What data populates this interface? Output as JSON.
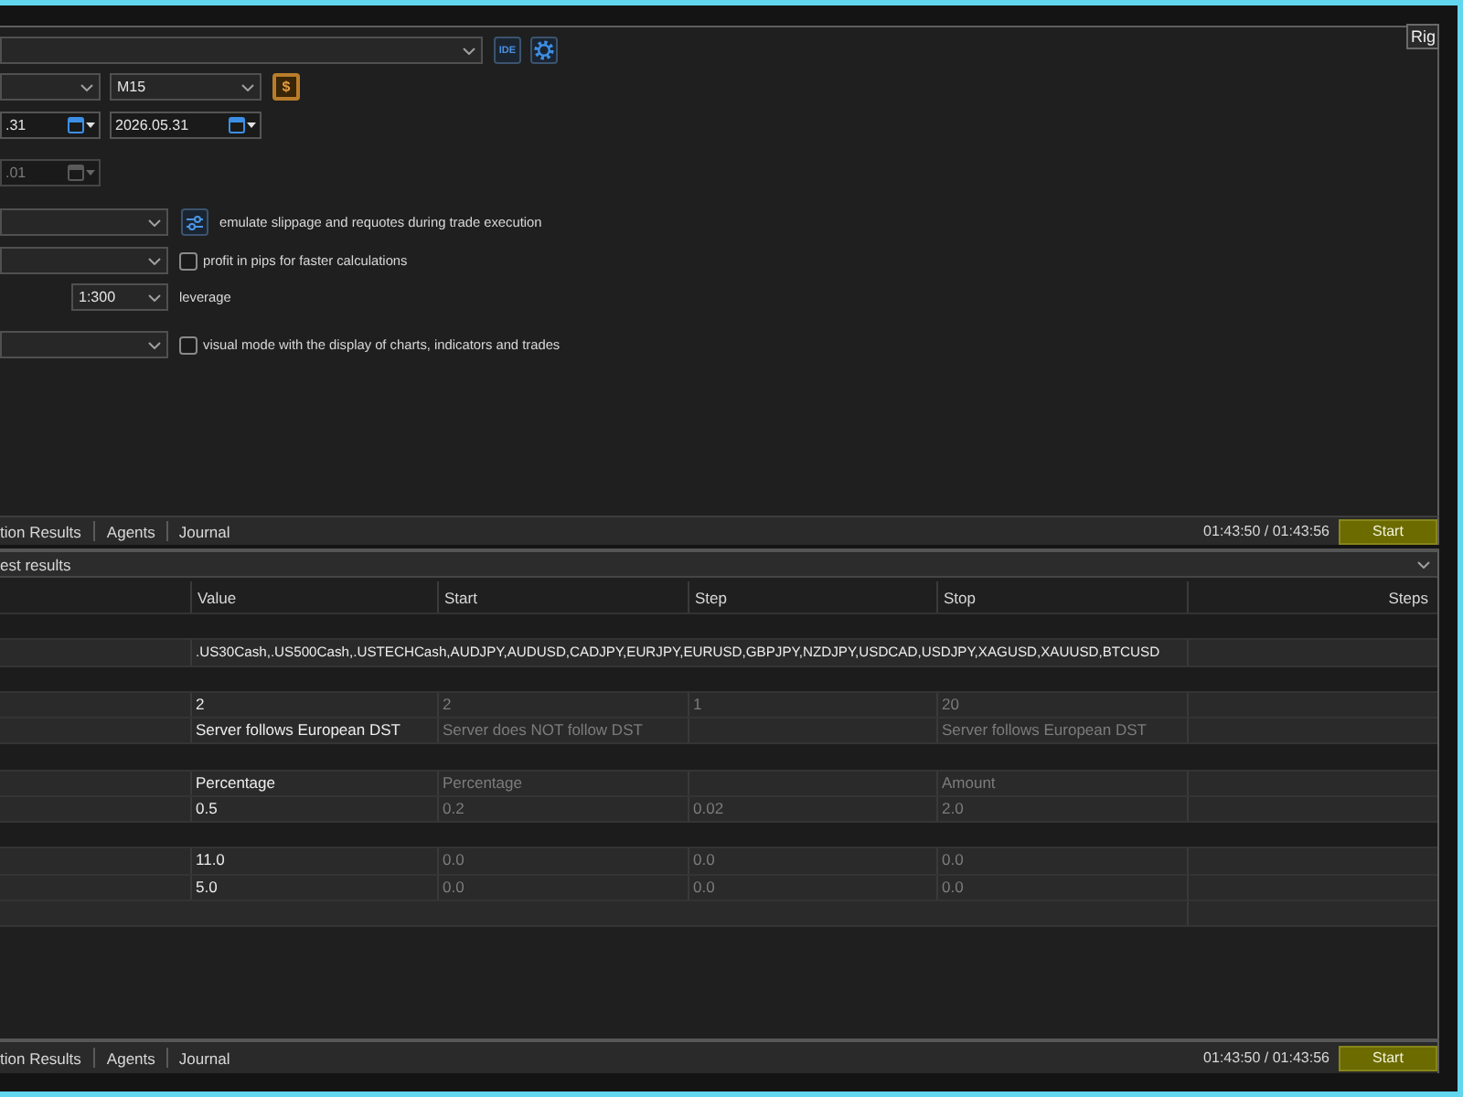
{
  "settings": {
    "tooltip": "Rig",
    "ide_button": "IDE",
    "timeframe": "M15",
    "symbol_button": "$",
    "date_from": ".31",
    "date_to": "2026.05.31",
    "forward_date": {
      "value": ".01",
      "disabled": true
    },
    "execution_note": "emulate slippage and requotes during trade execution",
    "profit_in_pips": {
      "label": "profit in pips for faster calculations",
      "checked": false
    },
    "leverage": {
      "value": "1:300",
      "label": "leverage"
    },
    "visual_mode": {
      "label": "visual mode with the display of charts, indicators and trades",
      "checked": false
    }
  },
  "top_tab_bar": {
    "tabs": [
      {
        "label": "tion Results",
        "selected": false
      },
      {
        "label": "Agents",
        "selected": false
      },
      {
        "label": "Journal",
        "selected": false
      }
    ],
    "time": "01:43:50 / 01:43:56",
    "start_button": "Start"
  },
  "results": {
    "title": "est results",
    "columns": [
      "Value",
      "Start",
      "Step",
      "Stop",
      "Steps"
    ],
    "rows": [
      {
        "kind": "group"
      },
      {
        "kind": "list",
        "value": ".US30Cash,.US500Cash,.USTECHCash,AUDJPY,AUDUSD,CADJPY,EURJPY,EURUSD,GBPJPY,NZDJPY,USDCAD,USDJPY,XAGUSD,XAUUSD,BTCUSD"
      },
      {
        "kind": "group"
      },
      {
        "kind": "param",
        "value": "2",
        "start": "2",
        "step": "1",
        "stop": "20"
      },
      {
        "kind": "param",
        "value": "Server follows European DST",
        "start": "Server does NOT follow DST",
        "stop": "Server follows European DST"
      },
      {
        "kind": "group"
      },
      {
        "kind": "param",
        "value": "Percentage",
        "start": "Percentage",
        "stop": "Amount"
      },
      {
        "kind": "param",
        "value": "0.5",
        "start": "0.2",
        "step": "0.02",
        "stop": "2.0"
      },
      {
        "kind": "group"
      },
      {
        "kind": "param",
        "value": "11.0",
        "start": "0.0",
        "step": "0.0",
        "stop": "0.0"
      },
      {
        "kind": "param",
        "value": "5.0",
        "start": "0.0",
        "step": "0.0",
        "stop": "0.0"
      },
      {
        "kind": "blank"
      }
    ]
  },
  "bottom_tab_bar": {
    "tabs": [
      {
        "label": "tion Results",
        "selected": false
      },
      {
        "label": "Agents",
        "selected": false
      },
      {
        "label": "Journal",
        "selected": false
      }
    ],
    "time": "01:43:50 / 01:43:56",
    "start_button": "Start"
  }
}
